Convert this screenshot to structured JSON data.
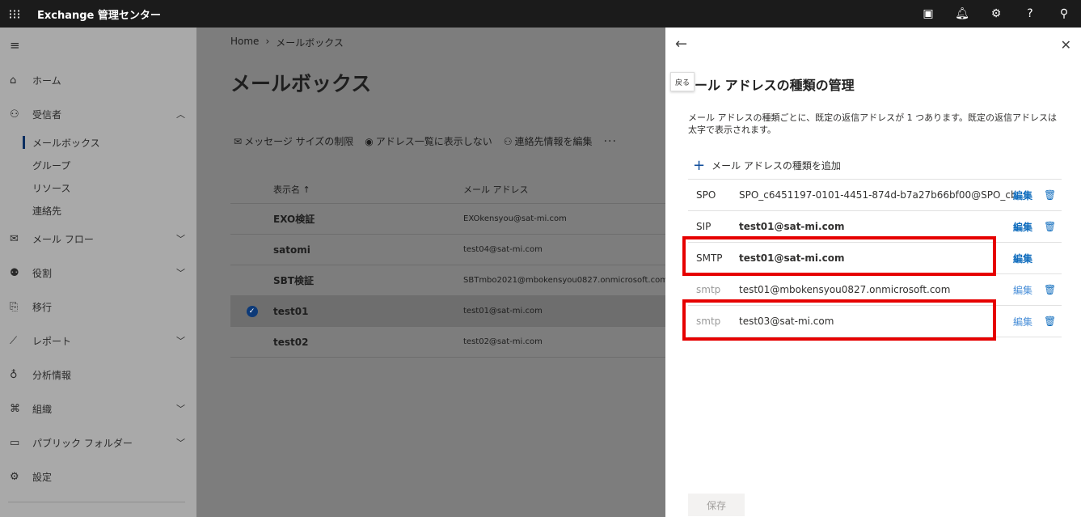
{
  "topbar": {
    "app_title": "Exchange 管理センター",
    "icons": [
      "waffle-icon",
      "cloud-shell-icon",
      "bell-icon",
      "gear-icon",
      "help-icon",
      "user-icon"
    ]
  },
  "nav": {
    "items": [
      {
        "label": "ホーム",
        "icon": "home-icon"
      },
      {
        "label": "受信者",
        "icon": "person-icon",
        "expanded": true,
        "children": [
          "メールボックス",
          "グループ",
          "リソース",
          "連絡先"
        ],
        "active_child": "メールボックス"
      },
      {
        "label": "メール フロー",
        "icon": "mail-icon"
      },
      {
        "label": "役割",
        "icon": "roles-icon"
      },
      {
        "label": "移行",
        "icon": "migration-icon"
      },
      {
        "label": "レポート",
        "icon": "chart-icon"
      },
      {
        "label": "分析情報",
        "icon": "lightbulb-icon"
      },
      {
        "label": "組織",
        "icon": "org-icon"
      },
      {
        "label": "パブリック フォルダー",
        "icon": "folder-icon"
      },
      {
        "label": "設定",
        "icon": "gear-icon"
      }
    ]
  },
  "main": {
    "breadcrumb": [
      "Home",
      "メールボックス"
    ],
    "title": "メールボックス",
    "commands": [
      "メッセージ サイズの制限",
      "アドレス一覧に表示しない",
      "連絡先情報を編集"
    ],
    "more": "···",
    "columns": {
      "name": "表示名 ↑",
      "email": "メール アドレス"
    },
    "rows": [
      {
        "name": "EXO検証",
        "email": "EXOkensyou@sat-mi.com",
        "selected": false
      },
      {
        "name": "satomi",
        "email": "test04@sat-mi.com",
        "selected": false
      },
      {
        "name": "SBT検証",
        "email": "SBTmbo2021@mbokensyou0827.onmicrosoft.com",
        "selected": false
      },
      {
        "name": "test01",
        "email": "test01@sat-mi.com",
        "selected": true
      },
      {
        "name": "test02",
        "email": "test02@sat-mi.com",
        "selected": false
      }
    ]
  },
  "panel": {
    "back_tooltip": "戻る",
    "title": "ール アドレスの種類の管理",
    "description": "メール アドレスの種類ごとに、既定の返信アドレスが 1 つあります。既定の返信アドレスは太字で表示されます。",
    "add_label": "メール アドレスの種類を追加",
    "edit_label": "編集",
    "addresses": [
      {
        "type": "SPO",
        "value": "SPO_c6451197-0101-4451-874d-b7a27b66bf00@SPO_cb",
        "primary": true,
        "bold_value": false,
        "deletable": true
      },
      {
        "type": "SIP",
        "value": "test01@sat-mi.com",
        "primary": true,
        "bold_value": true,
        "deletable": true
      },
      {
        "type": "SMTP",
        "value": "test01@sat-mi.com",
        "primary": true,
        "bold_value": true,
        "deletable": false
      },
      {
        "type": "smtp",
        "value": "test01@mbokensyou0827.onmicrosoft.com",
        "primary": false,
        "bold_value": false,
        "deletable": true
      },
      {
        "type": "smtp",
        "value": "test03@sat-mi.com",
        "primary": false,
        "bold_value": false,
        "deletable": true
      }
    ],
    "save_label": "保存",
    "highlight_color": "#e60000"
  }
}
